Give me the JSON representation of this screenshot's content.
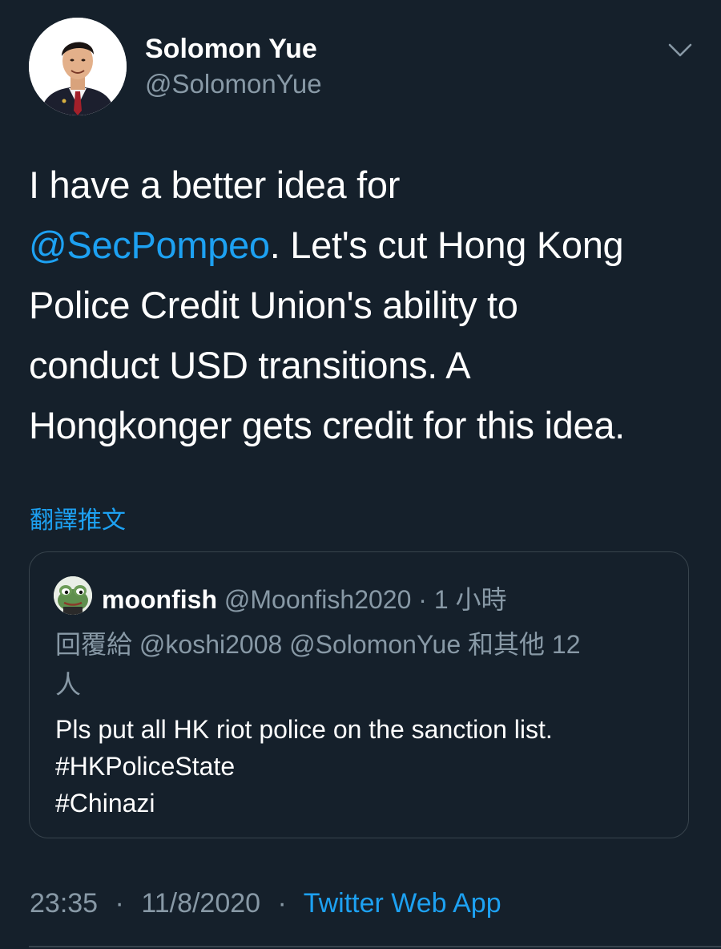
{
  "author": {
    "name": "Solomon Yue",
    "handle": "@SolomonYue",
    "avatar_icon": "user-photo-icon"
  },
  "menu": {
    "icon": "chevron-down-icon"
  },
  "tweet": {
    "line1": "I have a better idea for",
    "mention": "@SecPompeo",
    "line2_rest": ". Let's cut Hong Kong",
    "line3": "Police Credit Union's ability to",
    "line4": "conduct USD transitions. A",
    "line5": "Hongkonger gets credit for this idea."
  },
  "translate_label": "翻譯推文",
  "quote": {
    "name": "moonfish",
    "handle": "@Moonfish2020",
    "separator": "·",
    "time": "1 小時",
    "avatar_icon": "frog-avatar-icon",
    "reply_prefix": "回覆給",
    "reply_mentions": "@koshi2008 @SolomonYue",
    "reply_suffix": "和其他 12",
    "reply_suffix_line2": "人",
    "text_line1": "Pls put all HK riot police on the sanction list.",
    "text_line2": "#HKPoliceState",
    "text_line3": "#Chinazi"
  },
  "meta": {
    "time": "23:35",
    "separator": "·",
    "date": "11/8/2020",
    "source": "Twitter Web App"
  },
  "colors": {
    "background": "#15202b",
    "accent": "#1da1f2",
    "muted": "#8899a6",
    "border": "#38444d"
  }
}
